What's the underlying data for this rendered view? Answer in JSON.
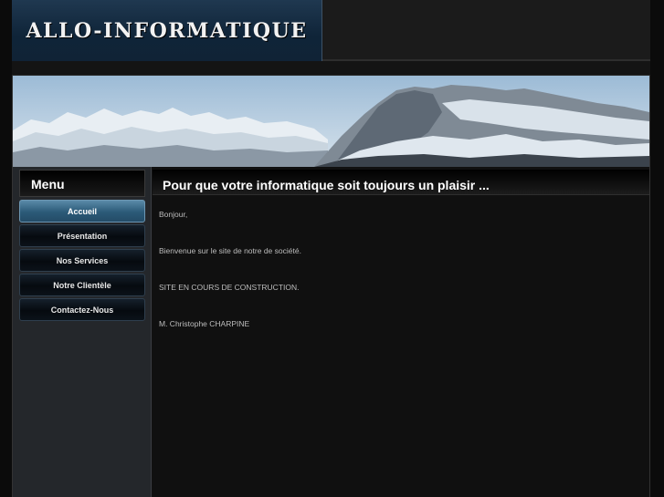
{
  "site": {
    "logo_text": "ALLO-INFORMATIQUE"
  },
  "menu": {
    "title": "Menu",
    "items": [
      {
        "label": "Accueil",
        "active": true
      },
      {
        "label": "Présentation",
        "active": false
      },
      {
        "label": "Nos Services",
        "active": false
      },
      {
        "label": "Notre Clientèle",
        "active": false
      },
      {
        "label": "Contactez-Nous",
        "active": false
      }
    ]
  },
  "content": {
    "title": "Pour que votre informatique soit toujours un plaisir ...",
    "paragraphs": [
      "Bonjour,",
      "Bienvenue sur le site de notre de société.",
      "SITE EN COURS DE CONSTRUCTION.",
      "M.  Christophe CHARPINE"
    ]
  },
  "colors": {
    "active_menu": "#2b5a78",
    "logo_bg": "#0f2438",
    "page_bg": "#0b0b0b"
  },
  "banner": {
    "image": "snowy-mountain-landscape"
  }
}
